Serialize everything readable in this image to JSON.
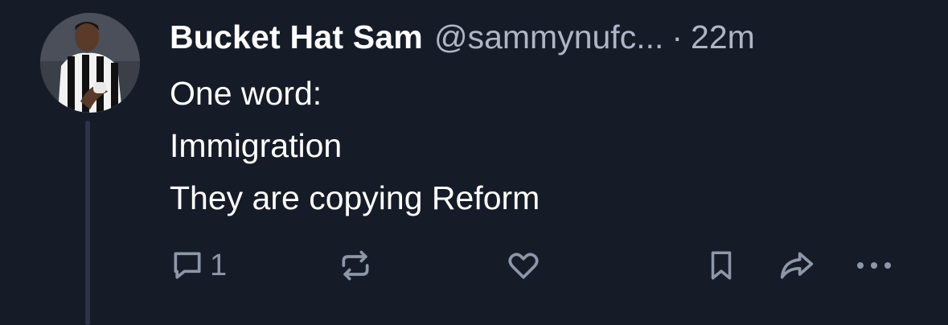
{
  "post": {
    "display_name": "Bucket Hat Sam",
    "handle": "@sammynufc...",
    "separator": "·",
    "time": "22m",
    "lines": [
      "One word:",
      "Immigration",
      "They are copying Reform"
    ]
  },
  "actions": {
    "reply": {
      "icon": "reply-icon",
      "count": "1"
    },
    "repost": {
      "icon": "repost-icon"
    },
    "like": {
      "icon": "heart-icon"
    },
    "bookmark": {
      "icon": "bookmark-icon"
    },
    "share": {
      "icon": "share-icon"
    },
    "more": {
      "icon": "more-icon"
    }
  },
  "colors": {
    "background": "#161c27",
    "text": "#ffffff",
    "muted": "#aeb6c5",
    "icon": "#8d97a8",
    "thread_line": "#2c3446"
  }
}
